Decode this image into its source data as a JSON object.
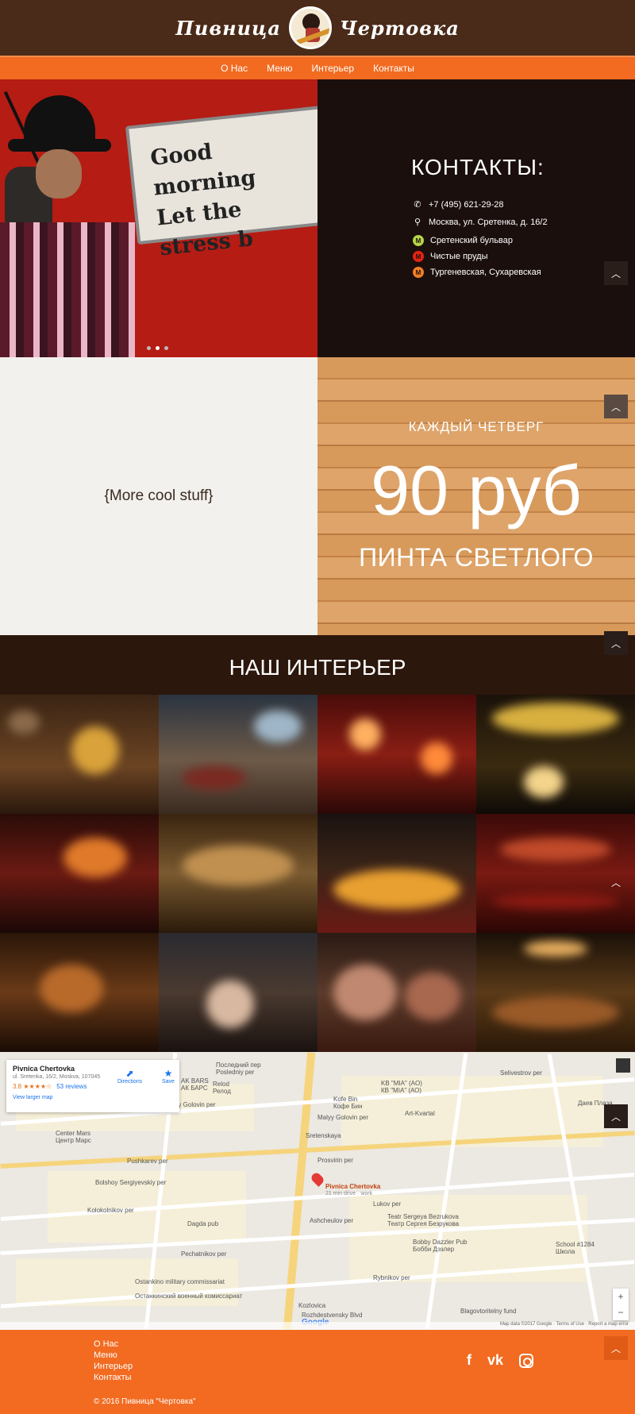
{
  "header": {
    "logo_left": "Пивница",
    "logo_right": "Чертовка"
  },
  "nav": {
    "items": [
      "О Нас",
      "Меню",
      "Интерьер",
      "Контакты"
    ]
  },
  "hero": {
    "sign_line1": "Good morning",
    "sign_line2": "Let the stress b",
    "slider_dots": 3,
    "active_dot": 2
  },
  "contacts": {
    "title": "КОНТАКТЫ:",
    "phone": "+7 (495) 621-29-28",
    "address": "Москва, ул. Сретенка, д. 16/2",
    "metro": [
      {
        "name": "Сретенский бульвар",
        "color": "#b4d445"
      },
      {
        "name": "Чистые пруды",
        "color": "#e42313"
      },
      {
        "name": "Тургеневская, Сухаревская",
        "color": "#f07e24"
      }
    ]
  },
  "promo": {
    "left_text": "{More cool stuff}",
    "kicker": "КАЖДЫЙ ЧЕТВЕРГ",
    "price": "90 руб",
    "sub": "ПИНТА СВЕТЛОГО"
  },
  "interior": {
    "title": "НАШ ИНТЕРЬЕР"
  },
  "map": {
    "place_name": "Pivnica Chertovka",
    "place_address": "ul. Sretenka, 16/2, Moskva, 107045",
    "rating": "3.8 ★★★★☆",
    "reviews": "53 reviews",
    "view_larger": "View larger map",
    "directions": "Directions",
    "save": "Save",
    "pin_label": "Pivnica Chertovka",
    "pin_sub": "21 min drive · work",
    "labels": [
      "Последний пер",
      "Posledniy per",
      "AK BARS",
      "АК БАРС",
      "Relod",
      "Релод",
      "Bolshoy Golovin per",
      "Kofe Bin",
      "Кофе Бин",
      "KB \"MIA\" (AO)",
      "КВ \"MIA\" (АО)",
      "Malyy Golovin per",
      "Art-Kvartal",
      "Sretenskaya",
      "Center Mars",
      "Центр Марс",
      "Pushkarev per",
      "Prosvirin per",
      "Bolshoy Sergiyevskiy per",
      "Lukov per",
      "Teatr Sergeya Bezrukova",
      "Театр Сергея Безрукова",
      "Kolokolnikov per",
      "Dagda pub",
      "Ashcheulov per",
      "Bobby Dazzler Pub",
      "Бобби Дэзлер",
      "Pechatnikov per",
      "School #1284",
      "Школа",
      "Ostankino military commissariat",
      "Останкинский военный комиссариат",
      "Rybnikov per",
      "Kozlovica",
      "Blagovtoritelny fund",
      "Rozhdestvensky Blvd",
      "Даев Плаза",
      "Selivestrov per"
    ],
    "footer_text": "Map data ©2017 Google · Terms of Use · Report a map error"
  },
  "footer": {
    "links": [
      "О Нас",
      "Меню",
      "Интерьер",
      "Контакты"
    ],
    "copyright": "© 2016 Пивница \"Чертовка\"",
    "social": [
      "f",
      "vk"
    ]
  },
  "colors": {
    "brand_brown": "#4a2a18",
    "brand_orange": "#f26b21",
    "dark": "#1a0f0d"
  }
}
